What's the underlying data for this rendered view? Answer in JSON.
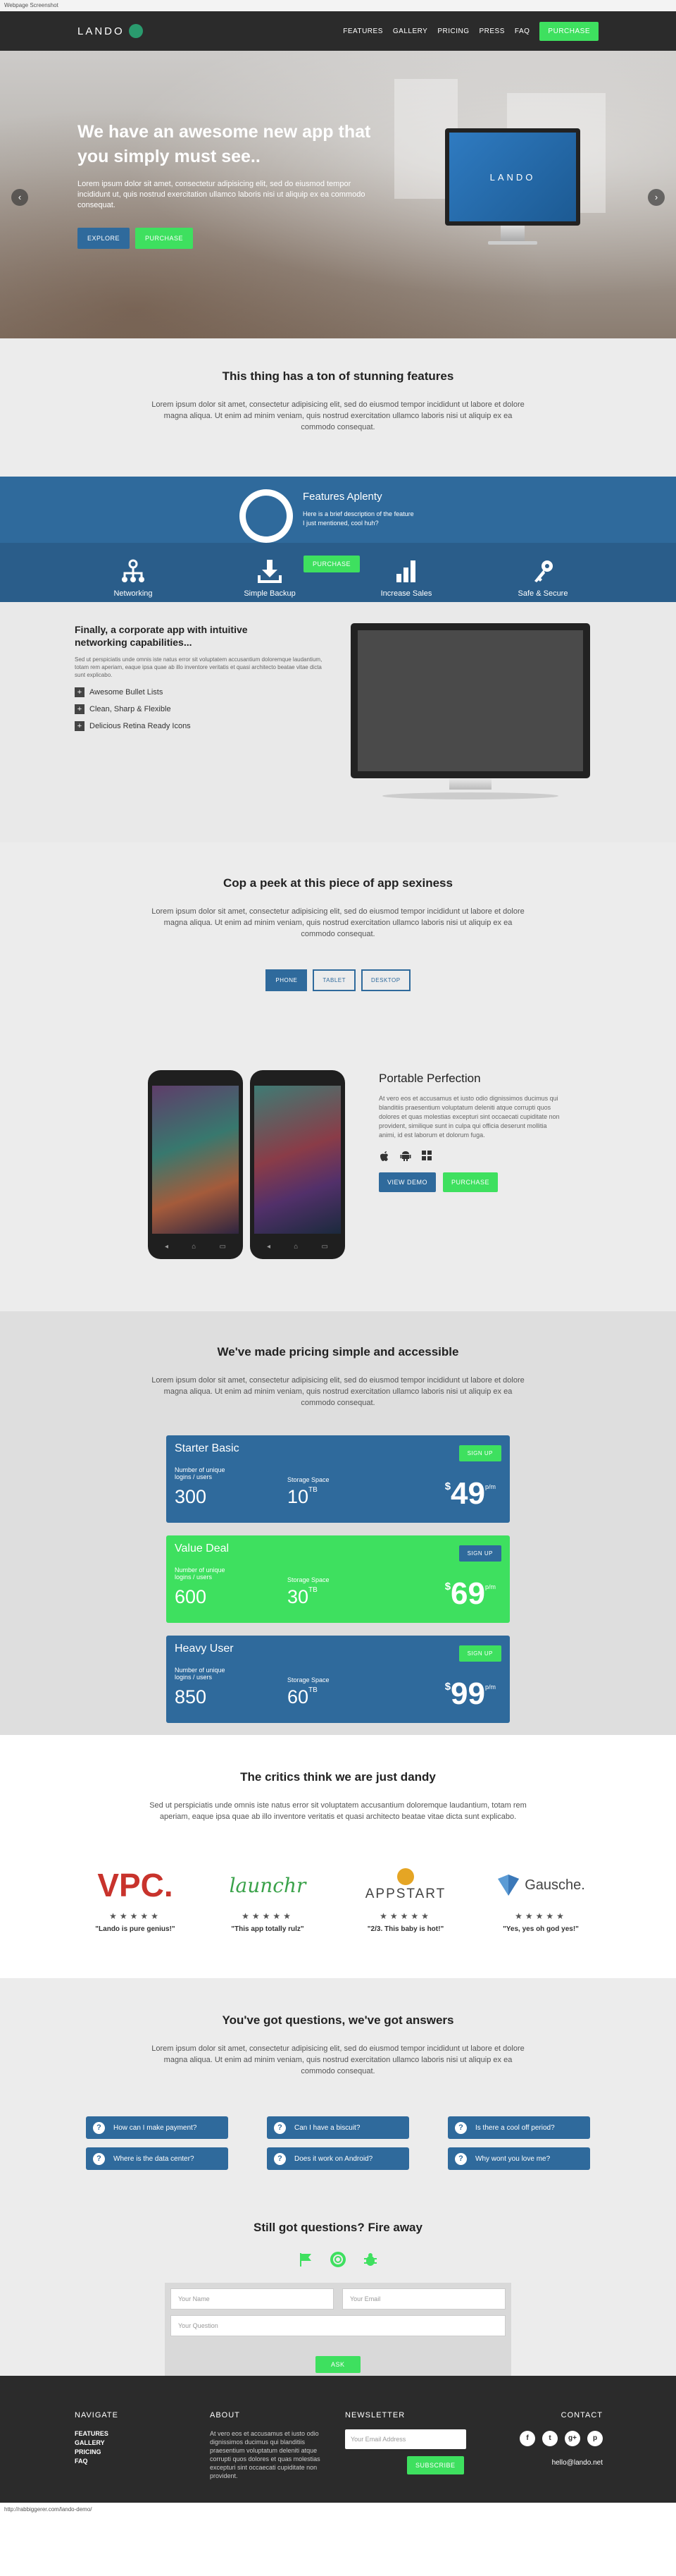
{
  "browser_note": "Webpage Screenshot",
  "footer_note": "http://rabbiggerer.com/lando-demo/",
  "colors": {
    "blue": "#2f6a9c",
    "green": "#3ee05f",
    "dark": "#2b2b2b"
  },
  "nav": {
    "logo": "LANDO",
    "items": [
      "FEATURES",
      "GALLERY",
      "PRICING",
      "PRESS",
      "FAQ"
    ],
    "purchase": "PURCHASE"
  },
  "hero": {
    "title": "We have an awesome new app that you simply must see..",
    "text": "Lorem ipsum dolor sit amet, consectetur adipisicing elit, sed do eiusmod tempor incididunt ut, quis nostrud exercitation ullamco laboris nisi ut aliquip ex ea commodo consequat.",
    "explore": "EXPLORE",
    "purchase": "PURCHASE",
    "screen_logo": "LANDO",
    "prev": "‹",
    "next": "›"
  },
  "features": {
    "title": "This thing has a ton of stunning features",
    "text": "Lorem ipsum dolor sit amet, consectetur adipisicing elit, sed do eiusmod tempor incididunt ut labore et dolore magna aliqua. Ut enim ad minim veniam, quis nostrud exercitation ullamco laboris nisi ut aliquip ex ea commodo consequat.",
    "band_title": "Features Aplenty",
    "band_text": "Here is a brief description of the feature I just mentioned, cool huh?",
    "band_button": "PURCHASE",
    "items": [
      {
        "label": "Networking",
        "icon": "network-icon"
      },
      {
        "label": "Simple Backup",
        "icon": "download-icon"
      },
      {
        "label": "Increase Sales",
        "icon": "bar-chart-icon"
      },
      {
        "label": "Safe & Secure",
        "icon": "key-icon"
      }
    ]
  },
  "corporate": {
    "title": "Finally, a corporate app with intuitive networking capabilities...",
    "text": "Sed ut perspiciatis unde omnis iste natus error sit voluptatem accusantium doloremque laudantium, totam rem aperiam, eaque ipsa quae ab illo inventore veritatis et quasi architecto beatae vitae dicta sunt explicabo.",
    "bullets": [
      "Awesome Bullet Lists",
      "Clean, Sharp & Flexible",
      "Delicious Retina Ready Icons"
    ]
  },
  "peek": {
    "title": "Cop a peek at this piece of app sexiness",
    "text": "Lorem ipsum dolor sit amet, consectetur adipisicing elit, sed do eiusmod tempor incididunt ut labore et dolore magna aliqua. Ut enim ad minim veniam, quis nostrud exercitation ullamco laboris nisi ut aliquip ex ea commodo consequat.",
    "tabs": [
      "PHONE",
      "TABLET",
      "DESKTOP"
    ],
    "active_tab": "PHONE",
    "portable_title": "Portable Perfection",
    "portable_text": "At vero eos et accusamus et iusto odio dignissimos ducimus qui blanditiis praesentium voluptatum deleniti atque corrupti quos dolores et quas molestias excepturi sint occaecati cupiditate non provident, similique sunt in culpa qui officia deserunt mollitia animi, id est laborum et dolorum fuga.",
    "os_icons": [
      "apple-icon",
      "android-icon",
      "windows-icon"
    ],
    "view_demo": "VIEW DEMO",
    "purchase": "PURCHASE"
  },
  "pricing": {
    "title": "We've made pricing simple and accessible",
    "text": "Lorem ipsum dolor sit amet, consectetur adipisicing elit, sed do eiusmod tempor incididunt ut labore et dolore magna aliqua. Ut enim ad minim veniam, quis nostrud exercitation ullamco laboris nisi ut aliquip ex ea commodo consequat.",
    "users_label": "Number of unique logins / users",
    "storage_label": "Storage Space",
    "unit": "TB",
    "currency": "$",
    "per": "p/m",
    "signup": "SIGN UP",
    "plans": [
      {
        "name": "Starter Basic",
        "users": "300",
        "storage": "10",
        "price": "49",
        "color": "blue"
      },
      {
        "name": "Value Deal",
        "users": "600",
        "storage": "30",
        "price": "69",
        "color": "green"
      },
      {
        "name": "Heavy User",
        "users": "850",
        "storage": "60",
        "price": "99",
        "color": "blue"
      }
    ]
  },
  "critics": {
    "title": "The critics think we are just dandy",
    "text": "Sed ut perspiciatis unde omnis iste natus error sit voluptatem accusantium doloremque laudantium, totam rem aperiam, eaque ipsa quae ab illo inventore veritatis et quasi architecto beatae vitae dicta sunt explicabo.",
    "stars": "★★★★★",
    "brands": [
      {
        "name": "VPC.",
        "quote": "\"Lando is pure genius!\""
      },
      {
        "name": "launchr",
        "quote": "\"This app totally rulz\""
      },
      {
        "name": "APPSTART",
        "quote": "\"2/3. This baby is hot!\""
      },
      {
        "name": "Gausche.",
        "quote": "\"Yes, yes oh god yes!\""
      }
    ]
  },
  "faq": {
    "title": "You've got questions, we've got answers",
    "text": "Lorem ipsum dolor sit amet, consectetur adipisicing elit, sed do eiusmod tempor incididunt ut labore et dolore magna aliqua. Ut enim ad minim veniam, quis nostrud exercitation ullamco laboris nisi ut aliquip ex ea commodo consequat.",
    "questions": [
      "How can I make payment?",
      "Can I have a biscuit?",
      "Is there a cool off period?",
      "Where is the data center?",
      "Does it work on Android?",
      "Why wont you love me?"
    ],
    "fire_title": "Still got questions? Fire away",
    "fire_icons": [
      "flag-icon",
      "lifebuoy-icon",
      "bug-icon"
    ],
    "name_placeholder": "Your Name",
    "email_placeholder": "Your Email",
    "question_placeholder": "Your Question",
    "ask": "ASK"
  },
  "footer": {
    "navigate_title": "NAVIGATE",
    "links": [
      "FEATURES",
      "GALLERY",
      "PRICING",
      "FAQ"
    ],
    "about_title": "ABOUT",
    "about_text": "At vero eos et accusamus et iusto odio dignissimos ducimus qui blanditiis praesentium voluptatum deleniti atque corrupti quos dolores et quas molestias excepturi sint occaecati cupiditate non provident.",
    "newsletter_title": "NEWSLETTER",
    "email_placeholder": "Your Email Address",
    "subscribe": "SUBSCRIBE",
    "contact_title": "CONTACT",
    "socials": [
      "f",
      "t",
      "g+",
      "p"
    ],
    "email": "hello@lando.net"
  }
}
